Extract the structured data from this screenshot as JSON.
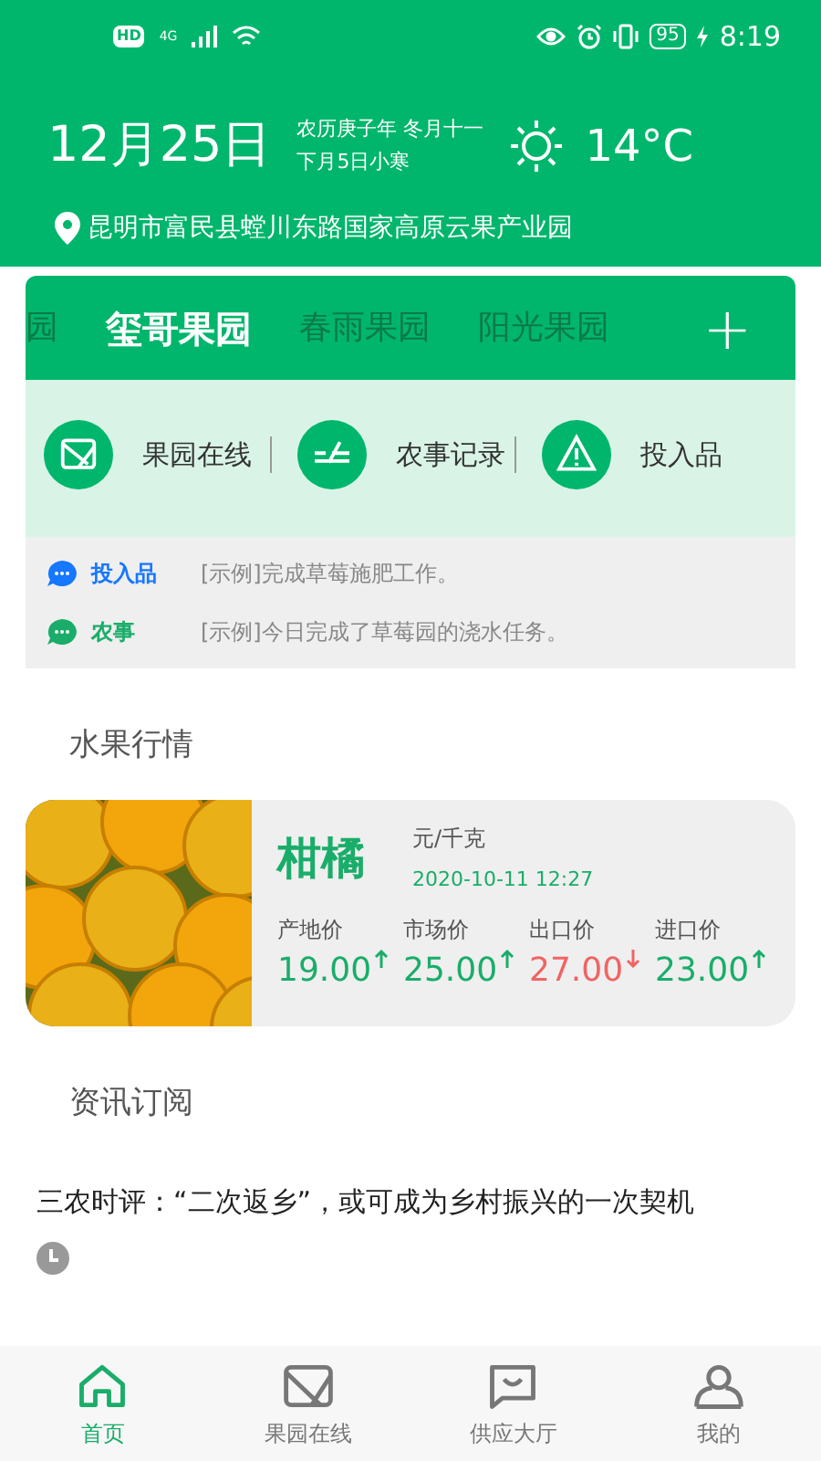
{
  "status_bar": {
    "hd": "HD",
    "network": "4G",
    "battery": "95",
    "time": "8:19"
  },
  "header": {
    "date": "12月25日",
    "lunar": "农历庚子年 冬月十一",
    "solar_term": "下月5日小寒",
    "temperature": "14°C",
    "location": "昆明市富民县螳川东路国家高原云果产业园"
  },
  "orchard_tabs": [
    {
      "label": "园",
      "selected": false
    },
    {
      "label": "玺哥果园",
      "selected": true
    },
    {
      "label": "春雨果园",
      "selected": false
    },
    {
      "label": "阳光果园",
      "selected": false
    }
  ],
  "add_button": "+",
  "actions": [
    {
      "kind": "monitor",
      "label": "果园在线"
    },
    {
      "kind": "record",
      "label": "农事记录"
    },
    {
      "kind": "warning",
      "label": "投入品"
    }
  ],
  "notices": [
    {
      "tag": "投入品",
      "color": "#1677ff",
      "text": "[示例]完成草莓施肥工作。"
    },
    {
      "tag": "农事",
      "color": "#1aad6a",
      "text": "[示例]今日完成了草莓园的浇水任务。"
    }
  ],
  "market": {
    "title": "水果行情",
    "item": {
      "kind": "picture",
      "name": "柑橘",
      "unit": "元/千克",
      "time": "2020-10-11 12:27",
      "prices": [
        {
          "label": "产地价",
          "value": "19.00",
          "kind": "up"
        },
        {
          "label": "市场价",
          "value": "25.00",
          "kind": "up"
        },
        {
          "label": "出口价",
          "value": "27.00",
          "kind": "down"
        },
        {
          "label": "进口价",
          "value": "23.00",
          "kind": "up"
        }
      ]
    }
  },
  "news": {
    "title": "资讯订阅",
    "items": [
      {
        "title": "三农时评：“二次返乡”，或可成为乡村振兴的一次契机"
      }
    ]
  },
  "bottom_nav": [
    {
      "kind": "home",
      "label": "首页",
      "selected": true
    },
    {
      "kind": "monitor",
      "label": "果园在线",
      "selected": false
    },
    {
      "kind": "chat",
      "label": "供应大厅",
      "selected": false
    },
    {
      "kind": "user",
      "label": "我的",
      "selected": false
    }
  ]
}
